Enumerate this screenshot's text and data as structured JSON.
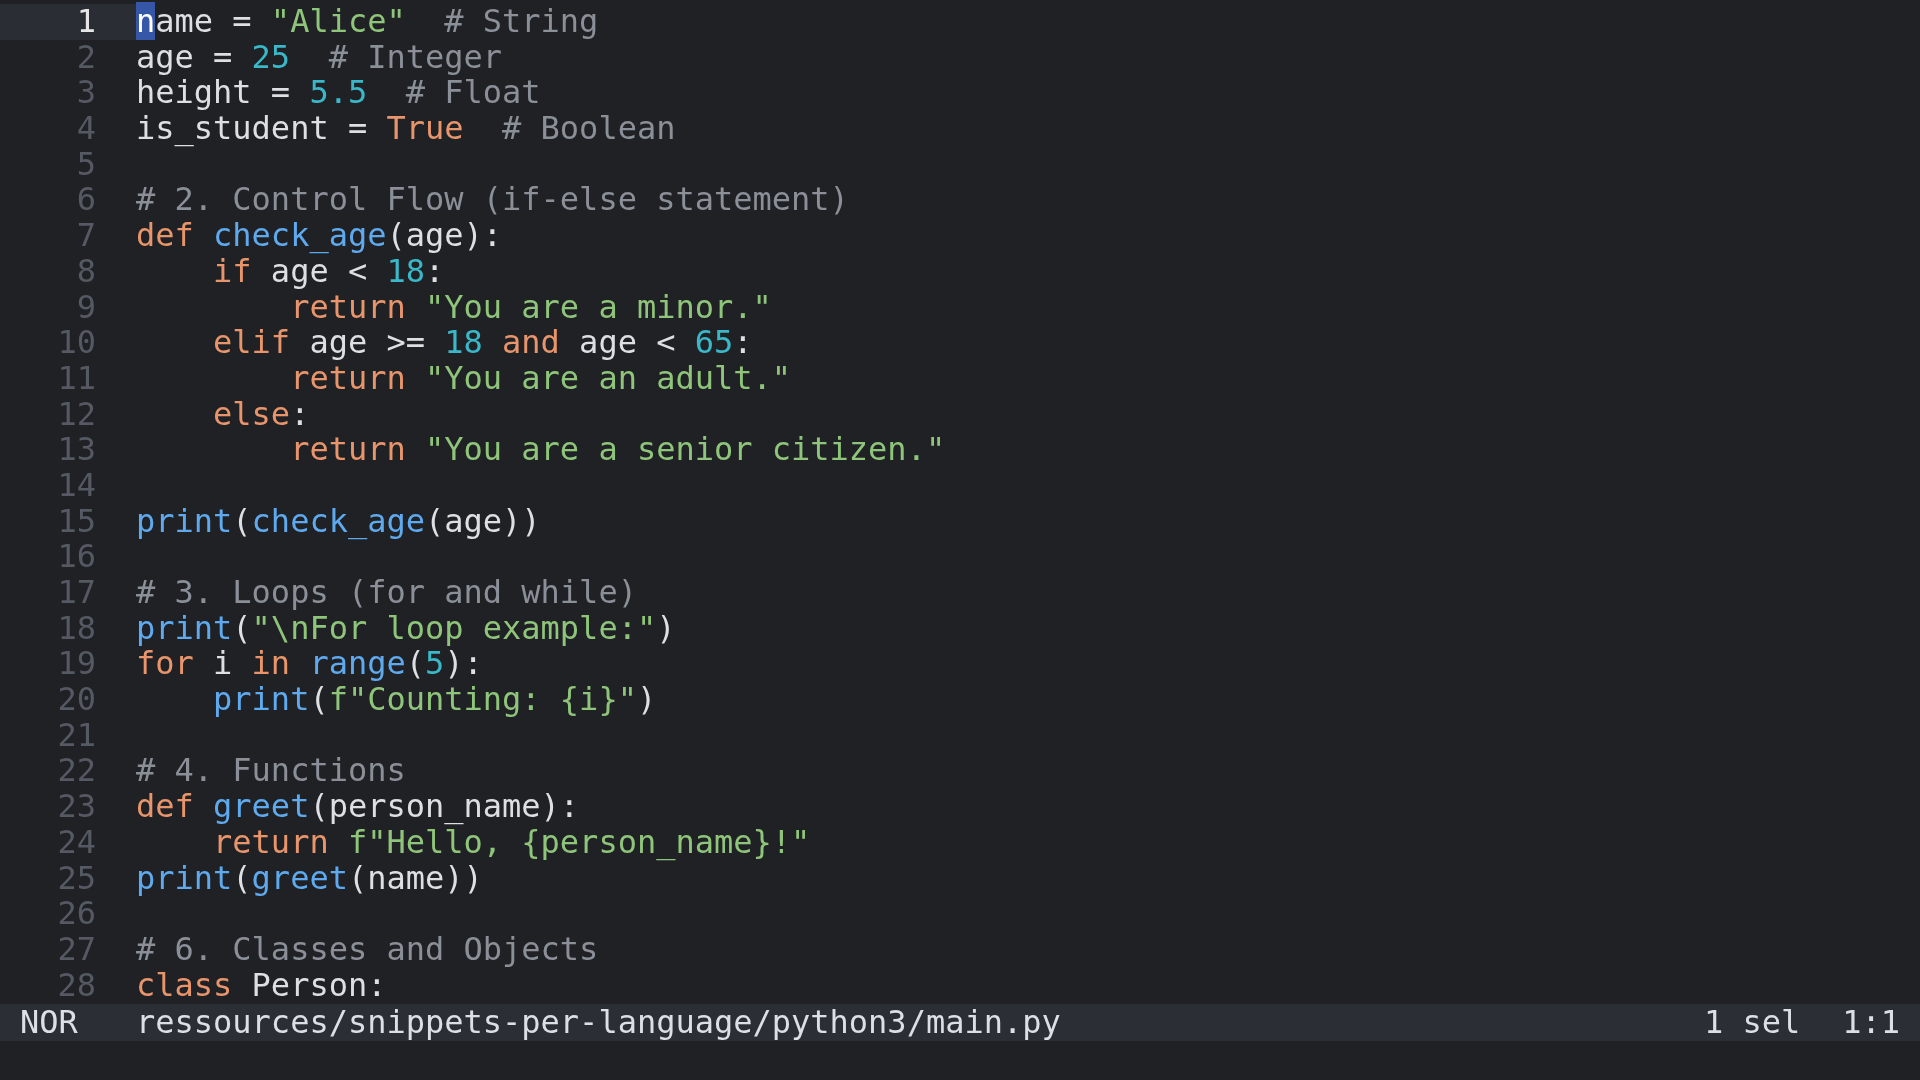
{
  "editor": {
    "lines": [
      {
        "number": "1",
        "current": true,
        "tokens": [
          {
            "kind": "cursor",
            "text": "n"
          },
          {
            "kind": "plain",
            "text": "ame = "
          },
          {
            "kind": "string",
            "text": "\"Alice\"  "
          },
          {
            "kind": "comment",
            "text": "# String"
          }
        ]
      },
      {
        "number": "2",
        "current": false,
        "tokens": [
          {
            "kind": "plain",
            "text": "age = "
          },
          {
            "kind": "number",
            "text": "25  "
          },
          {
            "kind": "comment",
            "text": "# Integer"
          }
        ]
      },
      {
        "number": "3",
        "current": false,
        "tokens": [
          {
            "kind": "plain",
            "text": "height = "
          },
          {
            "kind": "number",
            "text": "5.5  "
          },
          {
            "kind": "comment",
            "text": "# Float"
          }
        ]
      },
      {
        "number": "4",
        "current": false,
        "tokens": [
          {
            "kind": "plain",
            "text": "is_student = "
          },
          {
            "kind": "keyword",
            "text": "True  "
          },
          {
            "kind": "comment",
            "text": "# Boolean"
          }
        ]
      },
      {
        "number": "5",
        "current": false
      },
      {
        "number": "6",
        "current": false,
        "tokens": [
          {
            "kind": "comment",
            "text": "# 2. Control Flow (if-else statement)"
          }
        ]
      },
      {
        "number": "7",
        "current": false,
        "tokens": [
          {
            "kind": "keyword",
            "text": "def "
          },
          {
            "kind": "function",
            "text": "check_age"
          },
          {
            "kind": "plain",
            "text": "(age):"
          }
        ]
      },
      {
        "number": "8",
        "current": false,
        "tokens": [
          {
            "kind": "keyword",
            "text": "    if"
          },
          {
            "kind": "plain",
            "text": " age < "
          },
          {
            "kind": "number",
            "text": "18"
          },
          {
            "kind": "plain",
            "text": ":"
          }
        ]
      },
      {
        "number": "9",
        "current": false,
        "tokens": [
          {
            "kind": "keyword",
            "text": "        return "
          },
          {
            "kind": "string",
            "text": "\"You are a minor.\""
          }
        ]
      },
      {
        "number": "10",
        "current": false,
        "tokens": [
          {
            "kind": "keyword",
            "text": "    elif"
          },
          {
            "kind": "plain",
            "text": " age >= "
          },
          {
            "kind": "number",
            "text": "18 "
          },
          {
            "kind": "keyword",
            "text": "and"
          },
          {
            "kind": "plain",
            "text": " age < "
          },
          {
            "kind": "number",
            "text": "65"
          },
          {
            "kind": "plain",
            "text": ":"
          }
        ]
      },
      {
        "number": "11",
        "current": false,
        "tokens": [
          {
            "kind": "keyword",
            "text": "        return "
          },
          {
            "kind": "string",
            "text": "\"You are an adult.\""
          }
        ]
      },
      {
        "number": "12",
        "current": false,
        "tokens": [
          {
            "kind": "keyword",
            "text": "    else"
          },
          {
            "kind": "plain",
            "text": ":"
          }
        ]
      },
      {
        "number": "13",
        "current": false,
        "tokens": [
          {
            "kind": "keyword",
            "text": "        return "
          },
          {
            "kind": "string",
            "text": "\"You are a senior citizen.\""
          }
        ]
      },
      {
        "number": "14",
        "current": false
      },
      {
        "number": "15",
        "current": false,
        "tokens": [
          {
            "kind": "function",
            "text": "print"
          },
          {
            "kind": "plain",
            "text": "("
          },
          {
            "kind": "function",
            "text": "check_age"
          },
          {
            "kind": "plain",
            "text": "(age))"
          }
        ]
      },
      {
        "number": "16",
        "current": false
      },
      {
        "number": "17",
        "current": false,
        "tokens": [
          {
            "kind": "comment",
            "text": "# 3. Loops (for and while)"
          }
        ]
      },
      {
        "number": "18",
        "current": false,
        "tokens": [
          {
            "kind": "function",
            "text": "print"
          },
          {
            "kind": "plain",
            "text": "("
          },
          {
            "kind": "string",
            "text": "\"\\nFor loop example:\""
          },
          {
            "kind": "plain",
            "text": ")"
          }
        ]
      },
      {
        "number": "19",
        "current": false,
        "tokens": [
          {
            "kind": "keyword",
            "text": "for"
          },
          {
            "kind": "plain",
            "text": " i "
          },
          {
            "kind": "keyword",
            "text": "in "
          },
          {
            "kind": "function",
            "text": "range"
          },
          {
            "kind": "plain",
            "text": "("
          },
          {
            "kind": "number",
            "text": "5"
          },
          {
            "kind": "plain",
            "text": "):"
          }
        ]
      },
      {
        "number": "20",
        "current": false,
        "tokens": [
          {
            "kind": "function",
            "text": "    print"
          },
          {
            "kind": "plain",
            "text": "("
          },
          {
            "kind": "string",
            "text": "f\"Counting: {i}\""
          },
          {
            "kind": "plain",
            "text": ")"
          }
        ]
      },
      {
        "number": "21",
        "current": false
      },
      {
        "number": "22",
        "current": false,
        "tokens": [
          {
            "kind": "comment",
            "text": "# 4. Functions"
          }
        ]
      },
      {
        "number": "23",
        "current": false,
        "tokens": [
          {
            "kind": "keyword",
            "text": "def "
          },
          {
            "kind": "function",
            "text": "greet"
          },
          {
            "kind": "plain",
            "text": "(person_name):"
          }
        ]
      },
      {
        "number": "24",
        "current": false,
        "tokens": [
          {
            "kind": "keyword",
            "text": "    return "
          },
          {
            "kind": "string",
            "text": "f\"Hello, {person_name}!\""
          }
        ]
      },
      {
        "number": "25",
        "current": false,
        "tokens": [
          {
            "kind": "function",
            "text": "print"
          },
          {
            "kind": "plain",
            "text": "("
          },
          {
            "kind": "function",
            "text": "greet"
          },
          {
            "kind": "plain",
            "text": "(name))"
          }
        ]
      },
      {
        "number": "26",
        "current": false
      },
      {
        "number": "27",
        "current": false,
        "tokens": [
          {
            "kind": "comment",
            "text": "# 6. Classes and Objects"
          }
        ]
      },
      {
        "number": "28",
        "current": false,
        "tokens": [
          {
            "kind": "keyword",
            "text": "class"
          },
          {
            "kind": "plain",
            "text": " Person:"
          }
        ]
      }
    ]
  },
  "status_bar": {
    "mode": "NOR",
    "file_path": "ressources/snippets-per-language/python3/main.py",
    "selections": "1 sel",
    "position": "1:1"
  }
}
